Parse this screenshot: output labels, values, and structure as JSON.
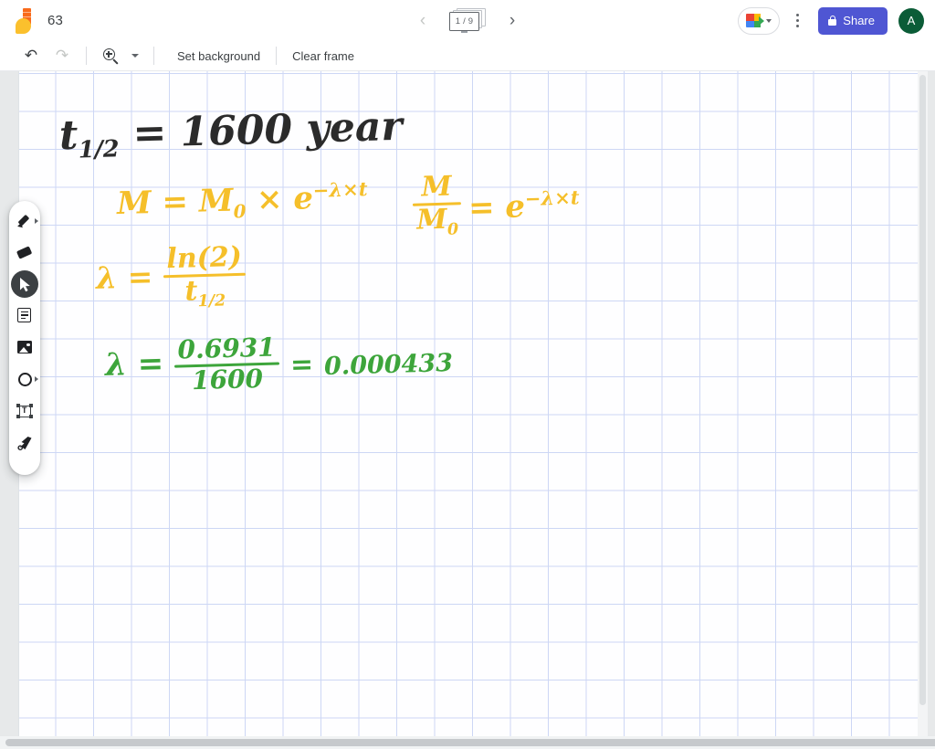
{
  "app": {
    "logo_icon": "jamboard-logo-icon",
    "title": "63"
  },
  "navigation": {
    "prev_icon": "chevron-left-icon",
    "next_icon": "chevron-right-icon",
    "frame_indicator": "1 / 9",
    "frame_icon": "frame-stack-icon"
  },
  "header_actions": {
    "meet_icon": "google-meet-icon",
    "meet_caret_icon": "chevron-down-icon",
    "more_icon": "more-vertical-icon",
    "share_label": "Share",
    "share_lock_icon": "lock-icon",
    "share_color": "#4F56D3",
    "avatar_initial": "A",
    "avatar_color": "#0B5C37"
  },
  "toolbar": {
    "undo_icon": "undo-icon",
    "undo_glyph": "↶",
    "redo_icon": "redo-icon",
    "redo_glyph": "↷",
    "zoom_icon": "zoom-in-icon",
    "zoom_caret_icon": "chevron-down-icon",
    "set_background_label": "Set background",
    "clear_frame_label": "Clear frame"
  },
  "tool_rail": {
    "items": [
      {
        "name": "pen-tool",
        "icon": "pen-icon",
        "active": false,
        "has_submenu": true
      },
      {
        "name": "eraser-tool",
        "icon": "eraser-icon",
        "active": false,
        "has_submenu": false
      },
      {
        "name": "select-tool",
        "icon": "cursor-arrow-icon",
        "active": true,
        "has_submenu": false
      },
      {
        "name": "sticky-note-tool",
        "icon": "sticky-note-icon",
        "active": false,
        "has_submenu": false
      },
      {
        "name": "image-tool",
        "icon": "image-icon",
        "active": false,
        "has_submenu": false
      },
      {
        "name": "shape-tool",
        "icon": "circle-shape-icon",
        "active": false,
        "has_submenu": true
      },
      {
        "name": "textbox-tool",
        "icon": "textbox-icon",
        "active": false,
        "has_submenu": false
      },
      {
        "name": "laser-tool",
        "icon": "laser-pointer-icon",
        "active": false,
        "has_submenu": false
      }
    ]
  },
  "canvas": {
    "background": "grid",
    "grid_color": "#cdd7f5",
    "paper_color": "#fefeff",
    "ink_colors": {
      "dark": "#2b2b2b",
      "yellow": "#F5BF2A",
      "green": "#3DA53B"
    },
    "handwriting": {
      "line1_t": "t",
      "line1_sub": "1/2",
      "line1_rest": "= 1600 year",
      "eq1_lhs": "M = M",
      "eq1_sub": "0",
      "eq1_mid": "× e",
      "eq1_sup": "−λ×t",
      "eq2_num": "M",
      "eq2_den_m": "M",
      "eq2_den_sub": "0",
      "eq2_eq": "= e",
      "eq2_sup": "−λ×t",
      "eq3_lhs": "λ =",
      "eq3_num": "ln(2)",
      "eq3_den_t": "t",
      "eq3_den_sub": "1/2",
      "eq4_lhs": "λ =",
      "eq4_num": "0.6931",
      "eq4_den": "1600",
      "eq4_eq": "=",
      "eq4_result": "0.000433"
    }
  },
  "scrollbars": {
    "horizontal": "horizontal-scrollbar",
    "vertical": "vertical-scrollbar"
  }
}
